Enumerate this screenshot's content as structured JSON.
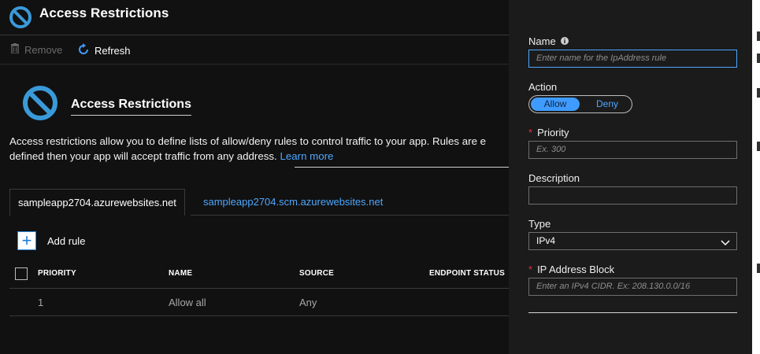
{
  "header": {
    "title": "Access Restrictions",
    "icon": "block-icon"
  },
  "toolbar": {
    "remove_label": "Remove",
    "refresh_label": "Refresh"
  },
  "section": {
    "title": "Access Restrictions",
    "description_line1": "Access restrictions allow you to define lists of allow/deny rules to control traffic to your app. Rules are e",
    "description_line2": "defined then your app will accept traffic from any address. ",
    "learn_more": "Learn more"
  },
  "tabs": [
    {
      "label": "sampleapp2704.azurewebsites.net",
      "active": true
    },
    {
      "label": "sampleapp2704.scm.azurewebsites.net",
      "active": false
    }
  ],
  "add_rule_label": "Add rule",
  "table": {
    "columns": [
      "PRIORITY",
      "NAME",
      "SOURCE",
      "ENDPOINT STATUS"
    ],
    "rows": [
      {
        "priority": "1",
        "name": "Allow all",
        "source": "Any",
        "endpoint_status": ""
      }
    ]
  },
  "panel": {
    "name_label": "Name",
    "name_placeholder": "Enter name for the IpAddress rule",
    "action_label": "Action",
    "action_allow": "Allow",
    "action_deny": "Deny",
    "action_selected": "Allow",
    "priority_label": "Priority",
    "priority_placeholder": "Ex. 300",
    "description_label": "Description",
    "description_value": "",
    "type_label": "Type",
    "type_value": "IPv4",
    "ip_label": "IP Address Block",
    "ip_placeholder": "Enter an IPv4 CIDR. Ex: 208.130.0.0/16",
    "required_marker": "*"
  },
  "colors": {
    "accent": "#4ea7ff",
    "required": "#e0343a",
    "background": "#111111",
    "panel": "#1b1b1b",
    "toggle_on": "#3f9bff"
  }
}
